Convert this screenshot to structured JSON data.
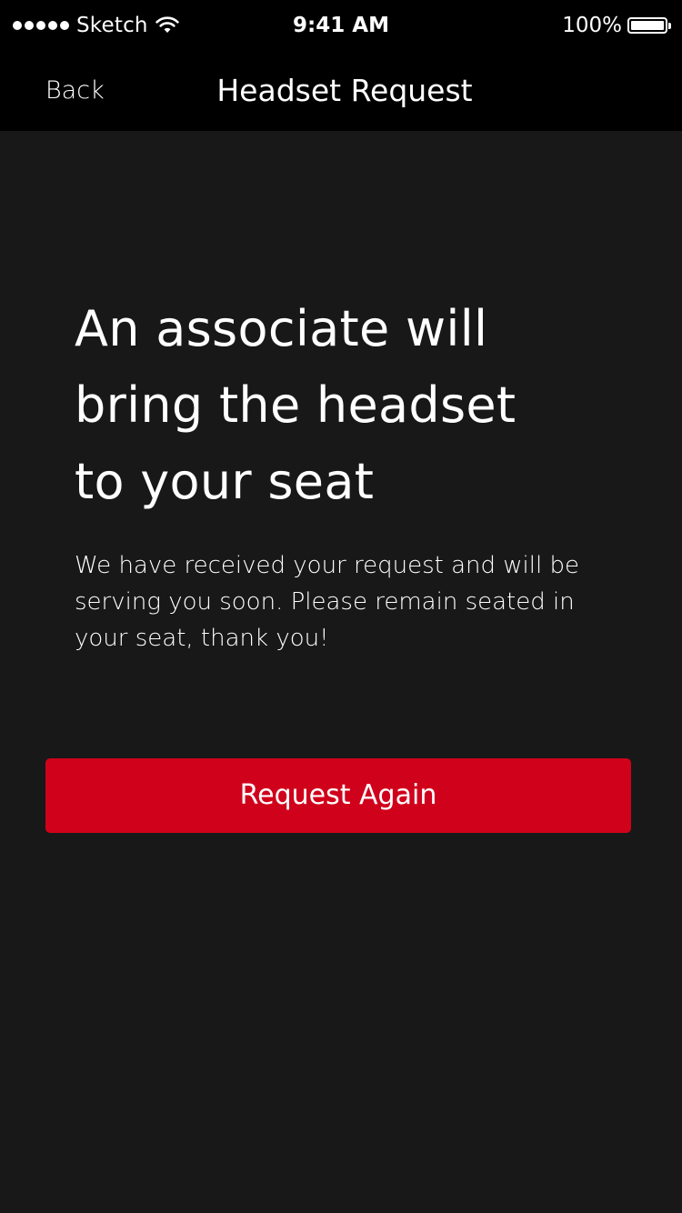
{
  "status_bar": {
    "carrier": "Sketch",
    "time": "9:41 AM",
    "battery_percent": "100%",
    "battery_level": 1.0,
    "signal_strength": 5,
    "icons": [
      "signal-dots-icon",
      "wifi-icon",
      "battery-icon"
    ]
  },
  "nav": {
    "back_label": "Back",
    "title": "Headset Request"
  },
  "main": {
    "headline": "An associate will\nbring the headset\nto your seat",
    "body": "We have received your request and will be serving you soon. Please remain seated in your seat, thank you!",
    "button_label": "Request Again"
  },
  "colors": {
    "background": "#181818",
    "bars": "#000000",
    "accent": "#d0021b",
    "text": "#ffffff"
  }
}
